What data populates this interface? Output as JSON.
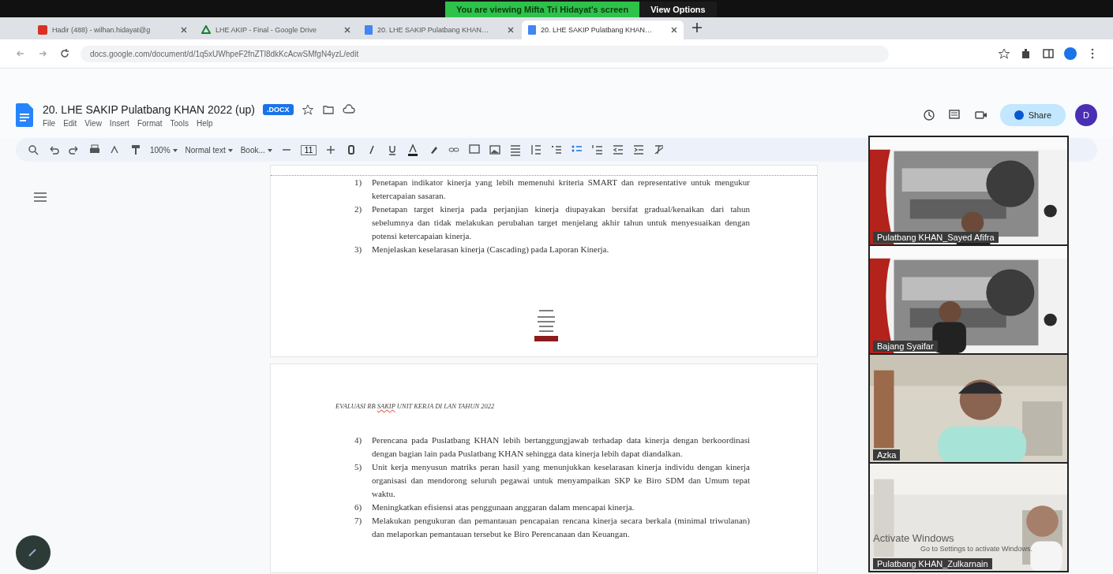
{
  "share_banner": {
    "text": "You are viewing Mifta Tri Hidayat's screen",
    "options": "View Options"
  },
  "browser": {
    "tabs": [
      {
        "title": "Hadir (488) - wilhan.hidayat@g",
        "selected": false
      },
      {
        "title": "LHE AKIP - Final - Google Drive",
        "selected": false
      },
      {
        "title": "20. LHE SAKIP Pulatbang KHAN…",
        "selected": false
      },
      {
        "title": "20. LHE SAKIP Pulatbang KHAN…",
        "selected": true
      }
    ],
    "url": "docs.google.com/document/d/1q5xUWhpeF2fnZTl8dkKcAcwSMfgN4yzL/edit"
  },
  "docs": {
    "title": "20. LHE SAKIP Pulatbang KHAN 2022 (up)",
    "badge": ".DOCX",
    "menu": [
      "File",
      "Edit",
      "View",
      "Insert",
      "Format",
      "Tools",
      "Help"
    ],
    "zoom": "100%",
    "style": "Normal text",
    "font": "Book...",
    "size": "11",
    "share": "Share",
    "avatar": "D"
  },
  "document": {
    "page1_items": [
      {
        "num": "1)",
        "text": "Penetapan indikator kinerja yang lebih memenuhi kriteria SMART dan representative untuk mengukur ketercapaian sasaran."
      },
      {
        "num": "2)",
        "text": "Penetapan target kinerja pada perjanjian kinerja diupayakan bersifat gradual/kenaikan dari tahun sebelumnya dan tidak melakukan perubahan target menjelang akhir tahun untuk menyesuaikan dengan potensi ketercapaian kinerja."
      },
      {
        "num": "3)",
        "text": "Menjelaskan keselarasan kinerja (Cascading) pada Laporan Kinerja."
      }
    ],
    "header": {
      "before": "EVALUASI RB ",
      "flagged": "SAKIP",
      "after": " UNIT KERJA DI LAN TAHUN 2022"
    },
    "page2_items": [
      {
        "num": "4)",
        "text": "Perencana pada Puslatbang KHAN lebih bertanggungjawab terhadap data kinerja dengan berkoordinasi dengan bagian lain pada Puslatbang KHAN sehingga data kinerja lebih dapat diandalkan."
      },
      {
        "num": "5)",
        "text": "Unit kerja menyusun matriks peran hasil yang menunjukkan keselarasan kinerja individu dengan kinerja organisasi dan mendorong seluruh pegawai untuk menyampaikan SKP ke Biro SDM dan Umum tepat waktu."
      },
      {
        "num": "6)",
        "text": "Meningkatkan efisiensi atas penggunaan anggaran dalam mencapai kinerja."
      },
      {
        "num": "7)",
        "text": "Melakukan pengukuran dan pemantauan pencapaian rencana kinerja secara berkala (minimal triwulanan) dan melaporkan pemantauan tersebut ke Biro Perencanaan dan Keuangan."
      }
    ]
  },
  "participants": [
    {
      "name": "Pulatbang KHAN_Sayed Afifra",
      "kind": "picture"
    },
    {
      "name": "Bajang Syaifar",
      "kind": "picture"
    },
    {
      "name": "Azka",
      "kind": "picture"
    },
    {
      "name": "Pulatbang KHAN_Zulkarnain",
      "kind": "picture"
    }
  ],
  "os_notice": [
    "Activate Windows",
    "Go to Settings to activate Windows."
  ]
}
